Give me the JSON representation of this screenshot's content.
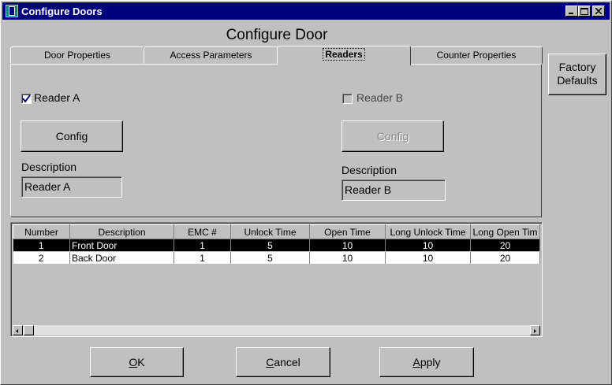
{
  "window": {
    "title": "Configure Doors"
  },
  "heading": "Configure Door",
  "tabs": [
    {
      "label": "Door Properties"
    },
    {
      "label": "Access Parameters"
    },
    {
      "label": "Readers"
    },
    {
      "label": "Counter Properties"
    }
  ],
  "factory_defaults": {
    "line1": "Factory",
    "line2": "Defaults"
  },
  "reader_a": {
    "label": "Reader A",
    "checked": true,
    "config_label": "Config",
    "description_label": "Description",
    "description_value": "Reader A"
  },
  "reader_b": {
    "label": "Reader B",
    "checked": false,
    "config_label": "Config",
    "description_label": "Description",
    "description_value": "Reader B"
  },
  "table": {
    "columns": [
      "Number",
      "Description",
      "EMC #",
      "Unlock Time",
      "Open Time",
      "Long Unlock Time",
      "Long Open Tim"
    ],
    "rows": [
      [
        "1",
        "Front Door",
        "1",
        "5",
        "10",
        "10",
        "20"
      ],
      [
        "2",
        "Back Door",
        "1",
        "5",
        "10",
        "10",
        "20"
      ]
    ]
  },
  "buttons": {
    "ok": "OK",
    "ok_mnemonic": "O",
    "ok_rest": "K",
    "cancel": "Cancel",
    "cancel_mnemonic": "C",
    "cancel_rest": "ancel",
    "apply": "Apply",
    "apply_mnemonic": "A",
    "apply_rest": "pply"
  }
}
